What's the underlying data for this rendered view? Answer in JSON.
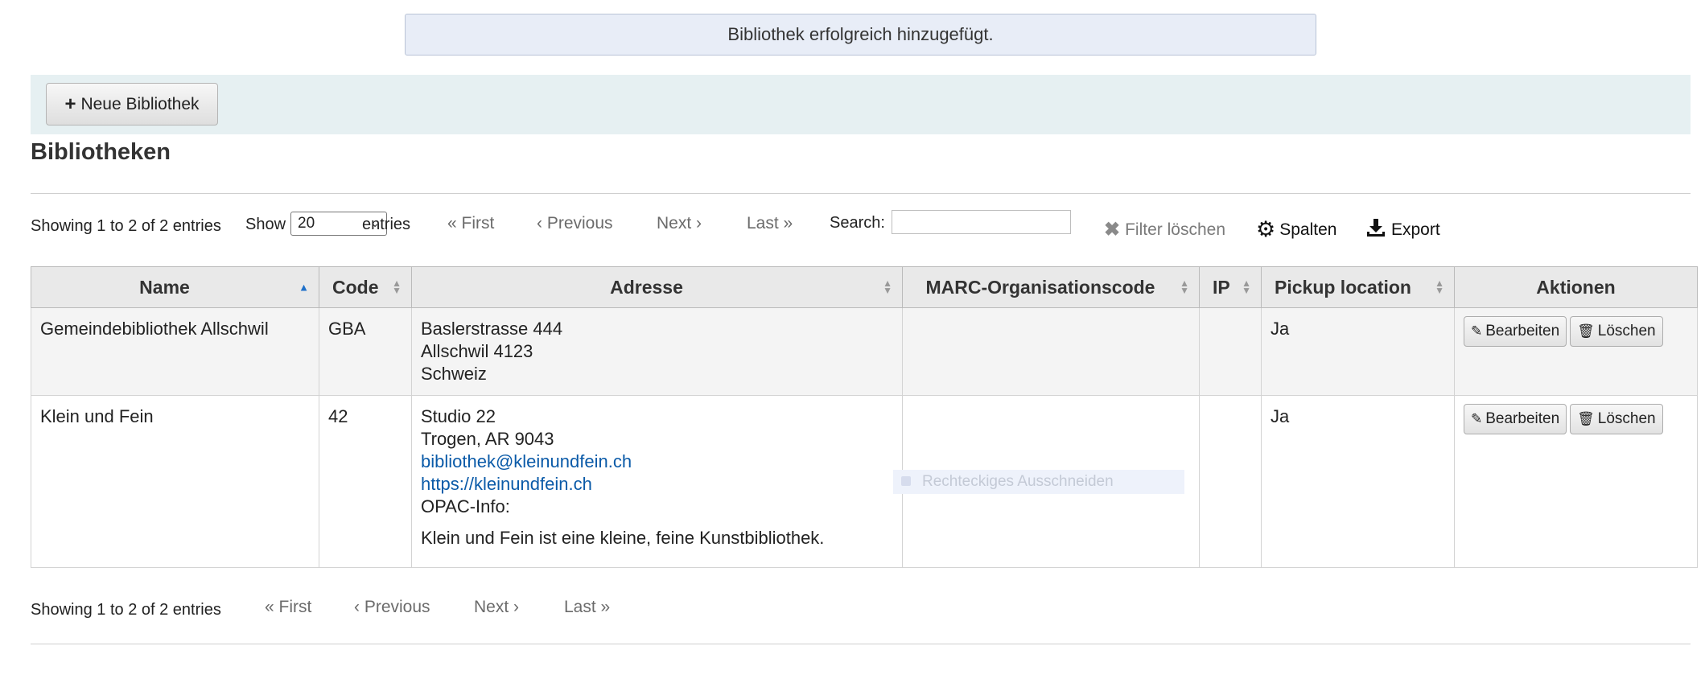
{
  "banner": {
    "message": "Bibliothek erfolgreich hinzugefügt."
  },
  "toolbar": {
    "new_library_label": "Neue Bibliothek"
  },
  "page_title": "Bibliotheken",
  "pager_top": {
    "info": "Showing 1 to 2 of 2 entries",
    "show_label": "Show",
    "show_value": "20",
    "entries_label": "entries",
    "first": "First",
    "previous": "Previous",
    "next": "Next",
    "last": "Last",
    "search_label": "Search:",
    "search_value": ""
  },
  "table_tools": {
    "clear_filter": "Filter löschen",
    "columns": "Spalten",
    "export": "Export"
  },
  "columns": [
    "Name",
    "Code",
    "Adresse",
    "MARC-Organisationscode",
    "IP",
    "Pickup location",
    "Aktionen"
  ],
  "rows": [
    {
      "name": "Gemeindebibliothek Allschwil",
      "code": "GBA",
      "address": [
        "Baslerstrasse 444",
        "Allschwil 4123",
        "Schweiz"
      ],
      "marc": "",
      "ip": "",
      "pickup": "Ja",
      "edit": "Bearbeiten",
      "delete": "Löschen"
    },
    {
      "name": "Klein und Fein",
      "code": "42",
      "address": [
        "Studio 22",
        "Trogen, AR 9043"
      ],
      "email": "bibliothek@kleinundfein.ch",
      "url": "https://kleinundfein.ch",
      "opac_label": "OPAC-Info:",
      "opac_text": "Klein und Fein ist eine kleine, feine Kunstbibliothek.",
      "marc": "",
      "ip": "",
      "pickup": "Ja",
      "edit": "Bearbeiten",
      "delete": "Löschen"
    }
  ],
  "pager_bottom": {
    "info": "Showing 1 to 2 of 2 entries",
    "first": "First",
    "previous": "Previous",
    "next": "Next",
    "last": "Last"
  },
  "overlay_hint": "Rechteckiges Ausschneiden"
}
